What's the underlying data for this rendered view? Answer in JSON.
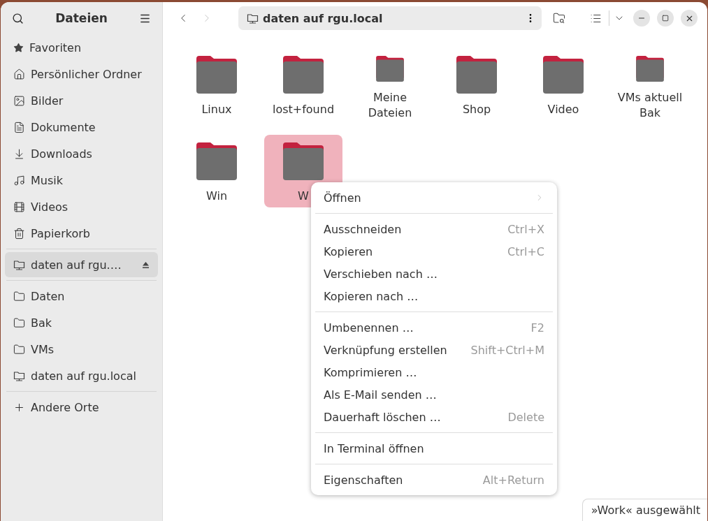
{
  "sidebar": {
    "title": "Dateien",
    "sections": [
      [
        {
          "label": "Favoriten",
          "kind": "star",
          "selected": false
        },
        {
          "label": "Persönlicher Ordner",
          "kind": "home",
          "selected": false
        },
        {
          "label": "Bilder",
          "kind": "image",
          "selected": false
        },
        {
          "label": "Dokumente",
          "kind": "document",
          "selected": false
        },
        {
          "label": "Downloads",
          "kind": "download",
          "selected": false
        },
        {
          "label": "Musik",
          "kind": "music",
          "selected": false
        },
        {
          "label": "Videos",
          "kind": "video",
          "selected": false
        },
        {
          "label": "Papierkorb",
          "kind": "trash",
          "selected": false
        }
      ],
      [
        {
          "label": "daten auf rgu.…",
          "kind": "network",
          "selected": true,
          "eject": true
        }
      ],
      [
        {
          "label": "Daten",
          "kind": "folder",
          "selected": false
        },
        {
          "label": "Bak",
          "kind": "folder",
          "selected": false
        },
        {
          "label": "VMs",
          "kind": "folder",
          "selected": false
        },
        {
          "label": "daten auf rgu.local",
          "kind": "network",
          "selected": false
        }
      ],
      [
        {
          "label": "Andere Orte",
          "kind": "plus",
          "selected": false
        }
      ]
    ]
  },
  "toolbar": {
    "back_disabled": false,
    "forward_disabled": true,
    "path": "daten auf rgu.local"
  },
  "folders": [
    {
      "name": "Linux",
      "selected": false
    },
    {
      "name": "lost+found",
      "selected": false
    },
    {
      "name": "Meine Dateien",
      "selected": false
    },
    {
      "name": "Shop",
      "selected": false
    },
    {
      "name": "Video",
      "selected": false
    },
    {
      "name": "VMs aktuell Bak",
      "selected": false
    },
    {
      "name": "Win",
      "selected": false
    },
    {
      "name": "W",
      "selected": true
    }
  ],
  "context_menu": [
    [
      {
        "label": "Öffnen",
        "submenu": true
      }
    ],
    [
      {
        "label": "Ausschneiden",
        "shortcut": "Ctrl+X"
      },
      {
        "label": "Kopieren",
        "shortcut": "Ctrl+C"
      },
      {
        "label": "Verschieben nach …"
      },
      {
        "label": "Kopieren nach …"
      }
    ],
    [
      {
        "label": "Umbenennen …",
        "shortcut": "F2"
      },
      {
        "label": "Verknüpfung erstellen",
        "shortcut": "Shift+Ctrl+M"
      },
      {
        "label": "Komprimieren …"
      },
      {
        "label": "Als E-Mail senden …"
      },
      {
        "label": "Dauerhaft löschen …",
        "shortcut": "Delete"
      }
    ],
    [
      {
        "label": "In Terminal öffnen"
      }
    ],
    [
      {
        "label": "Eigenschaften",
        "shortcut": "Alt+Return"
      }
    ]
  ],
  "status": "»Work« ausgewählt"
}
